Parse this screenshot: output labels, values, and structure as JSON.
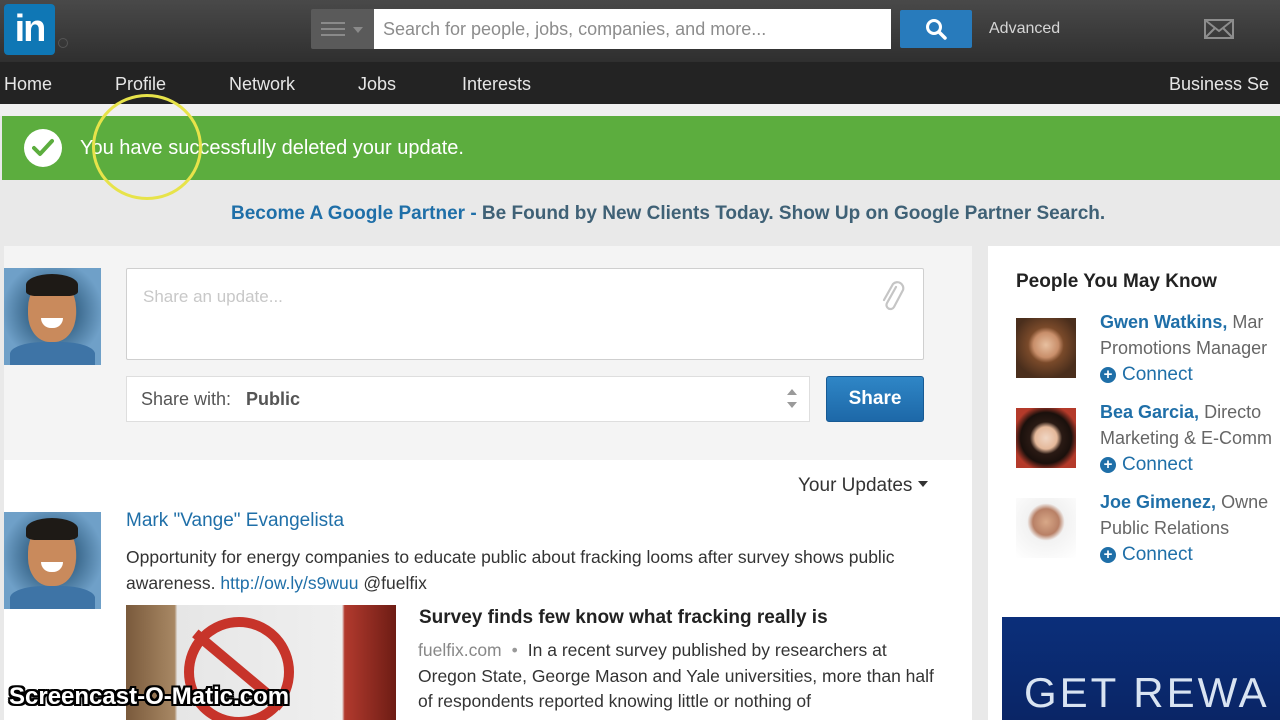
{
  "header": {
    "logo_text": "in",
    "search_placeholder": "Search for people, jobs, companies, and more...",
    "advanced_label": "Advanced"
  },
  "nav": {
    "items": [
      "Home",
      "Profile",
      "Network",
      "Jobs",
      "Interests",
      "Business Se"
    ]
  },
  "alert": {
    "message": "You have successfully deleted your update.",
    "color": "#5cad3e"
  },
  "ad": {
    "link_text": "Become A Google Partner -",
    "text": " Be Found by New Clients Today. Show Up on Google Partner Search."
  },
  "share": {
    "placeholder": "Share an update...",
    "share_with_label": "Share with:",
    "share_with_value": "Public",
    "share_button": "Share"
  },
  "feed": {
    "filter_label": "Your Updates",
    "post": {
      "author": "Mark \"Vange\" Evangelista",
      "text": "Opportunity for energy companies to educate public about fracking looms after survey shows public awareness.",
      "link": "http://ow.ly/s9wuu",
      "mention": "@fuelfix",
      "article_title": "Survey finds few know what fracking really is",
      "article_source": "fuelfix.com",
      "article_snippet": "In a recent survey published by researchers at Oregon State, George Mason and Yale universities, more than half of respondents reported knowing little or nothing of"
    }
  },
  "people_you_may_know": {
    "title": "People You May Know",
    "connect_label": "Connect",
    "people": [
      {
        "name": "Gwen Watkins,",
        "title_start": "Mar",
        "title_line2": "Promotions Manager"
      },
      {
        "name": "Bea Garcia,",
        "title_start": "Directo",
        "title_line2": "Marketing & E-Comm"
      },
      {
        "name": "Joe Gimenez,",
        "title_start": "Owne",
        "title_line2": "Public Relations"
      }
    ]
  },
  "rail_ad": {
    "text": "GET REWA"
  },
  "watermark": "Screencast-O-Matic.com",
  "colors": {
    "brand_blue": "#0f77b5",
    "link_blue": "#1f6fa8",
    "success_green": "#5cad3e",
    "topbar": "#3a3a3a"
  }
}
